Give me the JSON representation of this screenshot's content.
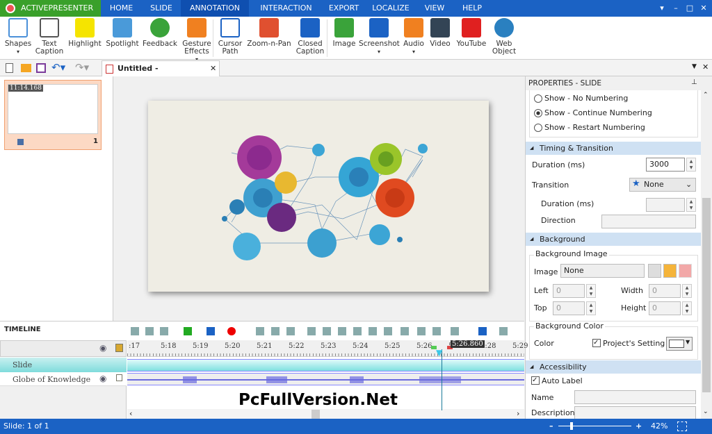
{
  "app": {
    "name": "ACTIVEPRESENTER"
  },
  "menu": [
    "HOME",
    "SLIDE",
    "ANNOTATION",
    "INTERACTION",
    "EXPORT",
    "LOCALIZE",
    "VIEW",
    "HELP"
  ],
  "menu_active": "ANNOTATION",
  "window_controls": {
    "help": "▾",
    "minimize": "–",
    "maximize": "□",
    "close": "✕"
  },
  "ribbon": [
    {
      "label": "Shapes",
      "icon": "shapes-icon",
      "dropdown": true
    },
    {
      "label": "Text\nCaption",
      "icon": "text-caption-icon"
    },
    {
      "label": "Highlight",
      "icon": "highlight-icon"
    },
    {
      "label": "Spotlight",
      "icon": "spotlight-icon"
    },
    {
      "label": "Feedback",
      "icon": "feedback-icon"
    },
    {
      "label": "Gesture\nEffects",
      "icon": "gesture-icon",
      "dropdown": true
    },
    {
      "label": "Cursor\nPath",
      "icon": "cursor-path-icon"
    },
    {
      "label": "Zoom-n-Pan",
      "icon": "zoom-pan-icon"
    },
    {
      "label": "Closed\nCaption",
      "icon": "cc-icon"
    },
    {
      "label": "Image",
      "icon": "image-icon"
    },
    {
      "label": "Screenshot",
      "icon": "screenshot-icon",
      "dropdown": true
    },
    {
      "label": "Audio",
      "icon": "audio-icon",
      "dropdown": true
    },
    {
      "label": "Video",
      "icon": "video-icon"
    },
    {
      "label": "YouTube",
      "icon": "youtube-icon"
    },
    {
      "label": "Web\nObject",
      "icon": "web-object-icon"
    }
  ],
  "document_tab": {
    "title": "Untitled - Untitled.approj*"
  },
  "slides_panel": {
    "thumb_time": "11:14.168",
    "thumb_number": "1"
  },
  "properties": {
    "title": "PROPERTIES - SLIDE",
    "numbering": [
      {
        "label": "Show - No Numbering",
        "checked": false
      },
      {
        "label": "Show - Continue Numbering",
        "checked": true
      },
      {
        "label": "Show - Restart Numbering",
        "checked": false
      }
    ],
    "timing": {
      "header": "Timing & Transition",
      "duration_label": "Duration (ms)",
      "duration": "3000",
      "transition_label": "Transition",
      "transition": "None",
      "sub_duration_label": "Duration (ms)",
      "direction_label": "Direction"
    },
    "background": {
      "header": "Background",
      "image_group": "Background Image",
      "image_label": "Image",
      "image_value": "None",
      "left_label": "Left",
      "left": "0",
      "top_label": "Top",
      "top": "0",
      "width_label": "Width",
      "width": "0",
      "height_label": "Height",
      "height": "0",
      "color_group": "Background Color",
      "color_label": "Color",
      "project_setting": "Project's Setting",
      "project_setting_checked": true,
      "color": "#ffffff"
    },
    "accessibility": {
      "header": "Accessibility",
      "auto_label": "Auto Label",
      "auto_label_checked": true,
      "name_label": "Name",
      "description_label": "Description"
    }
  },
  "timeline": {
    "title": "TIMELINE",
    "ticks": [
      ":17",
      "5:18",
      "5:19",
      "5:20",
      "5:21",
      "5:22",
      "5:23",
      "5:24",
      "5:25",
      "5:26",
      "5:27",
      "5:28",
      "5:29"
    ],
    "playhead": "5:26.860",
    "tracks": [
      {
        "name": "Slide"
      },
      {
        "name": "Globe of Knowledge"
      }
    ]
  },
  "watermark": "PcFullVersion.Net",
  "status": {
    "slide": "Slide: 1 of 1",
    "zoom": "42%",
    "zoom_level": 42
  },
  "colors": {
    "accent": "#1b62c4",
    "app_tab": "#3aa02a",
    "section": "#cfe1f3",
    "track": "#7fe0e0"
  }
}
